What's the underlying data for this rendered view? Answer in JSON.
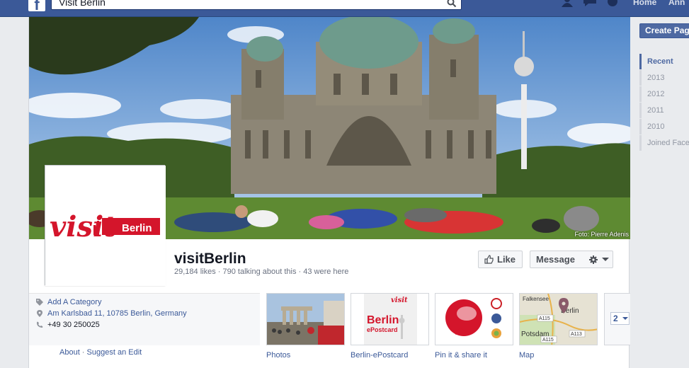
{
  "topbar": {
    "logo": "f",
    "search_value": "Visit Berlin",
    "nav_home": "Home",
    "nav_user": "Ann"
  },
  "cover": {
    "credit": "Foto: Pierre Adenis"
  },
  "page": {
    "name": "visitBerlin",
    "stats": "29,184 likes · 790 talking about this · 43 were here",
    "logo_visit": "visit",
    "logo_berlin": "Berlin"
  },
  "actions": {
    "like_label": "Like",
    "message_label": "Message"
  },
  "about": {
    "category": "Add A Category",
    "address": "Am Karlsbad 11, 10785 Berlin, Germany",
    "phone": "+49 30 250025",
    "about_link": "About",
    "separator": " · ",
    "suggest_link": "Suggest an Edit"
  },
  "apps": [
    {
      "label": "Photos"
    },
    {
      "label": "Berlin-ePostcard",
      "thumb_title": "Berlin",
      "thumb_sub": "ePostcard",
      "thumb_logo": "visit"
    },
    {
      "label": "Pin it & share it"
    },
    {
      "label": "Map",
      "place_1": "Falkensee",
      "place_2": "Berlin",
      "place_3": "Potsdam",
      "road_1": "A115",
      "road_2": "A113",
      "road_3": "A115"
    }
  ],
  "more_apps_count": "2",
  "sidebar": {
    "create_page": "Create Page",
    "timeline": [
      "Recent",
      "2013",
      "2012",
      "2011",
      "2010",
      "Joined Facebook"
    ]
  },
  "colors": {
    "fb_blue": "#3b5998",
    "brand_red": "#d4152b"
  }
}
